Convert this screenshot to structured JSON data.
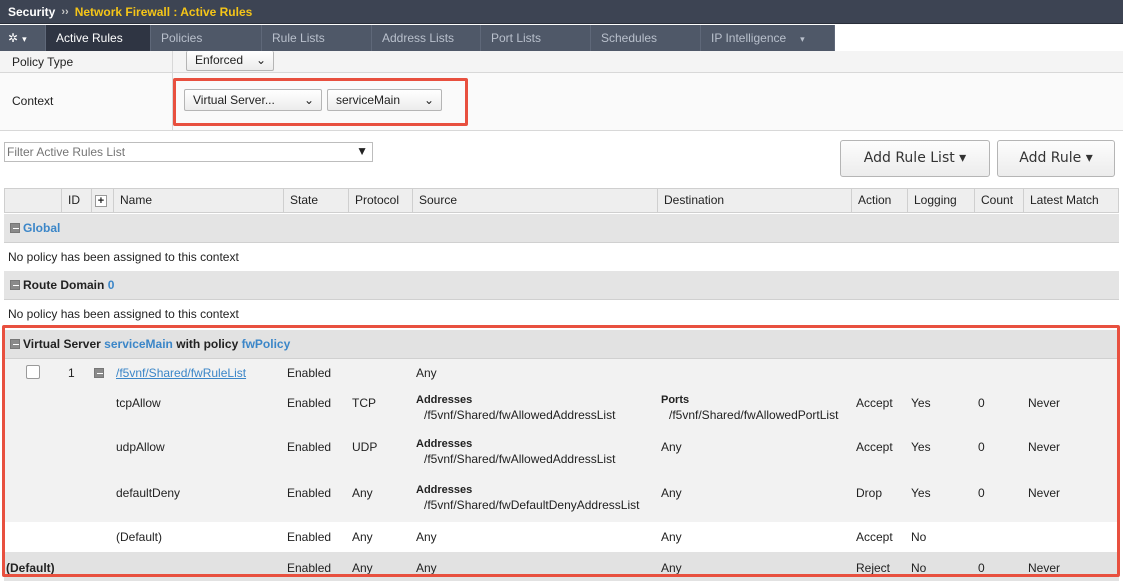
{
  "breadcrumb": {
    "root": "Security",
    "separator": "››",
    "page": "Network Firewall : Active Rules"
  },
  "tabs": [
    {
      "label": "Active Rules"
    },
    {
      "label": "Policies"
    },
    {
      "label": "Rule Lists"
    },
    {
      "label": "Address Lists"
    },
    {
      "label": "Port Lists"
    },
    {
      "label": "Schedules"
    },
    {
      "label": "IP Intelligence"
    }
  ],
  "context_form": {
    "policy_type_label": "Policy Type",
    "policy_type_value": "Enforced",
    "context_label": "Context",
    "context_type_value": "Virtual Server...",
    "context_object_value": "serviceMain"
  },
  "filter": {
    "placeholder": "Filter Active Rules List"
  },
  "buttons": {
    "add_rule_list": "Add Rule List ▾",
    "add_rule": "Add Rule ▾"
  },
  "columns": [
    "ID",
    "Name",
    "State",
    "Protocol",
    "Source",
    "Destination",
    "Action",
    "Logging",
    "Count",
    "Latest Match"
  ],
  "groups": {
    "global": {
      "label": "Global",
      "message": "No policy has been assigned to this context"
    },
    "route_domain": {
      "prefix": "Route Domain",
      "id": "0",
      "message": "No policy has been assigned to this context"
    },
    "virtual_server": {
      "prefix": "Virtual Server",
      "name": "serviceMain",
      "middle": "with policy",
      "policy": "fwPolicy"
    }
  },
  "rule_list_row": {
    "id": "1",
    "name": "/f5vnf/Shared/fwRuleList",
    "state": "Enabled",
    "source": "Any"
  },
  "rules": [
    {
      "name": "tcpAllow",
      "state": "Enabled",
      "protocol": "TCP",
      "source_label": "Addresses",
      "source_value": "/f5vnf/Shared/fwAllowedAddressList",
      "dest_label": "Ports",
      "dest_value": "/f5vnf/Shared/fwAllowedPortList",
      "action": "Accept",
      "logging": "Yes",
      "count": "0",
      "latest_match": "Never"
    },
    {
      "name": "udpAllow",
      "state": "Enabled",
      "protocol": "UDP",
      "source_label": "Addresses",
      "source_value": "/f5vnf/Shared/fwAllowedAddressList",
      "dest_label": "",
      "dest_value": "Any",
      "action": "Accept",
      "logging": "Yes",
      "count": "0",
      "latest_match": "Never"
    },
    {
      "name": "defaultDeny",
      "state": "Enabled",
      "protocol": "Any",
      "source_label": "Addresses",
      "source_value": "/f5vnf/Shared/fwDefaultDenyAddressList",
      "dest_label": "",
      "dest_value": "Any",
      "action": "Drop",
      "logging": "Yes",
      "count": "0",
      "latest_match": "Never"
    }
  ],
  "default_row": {
    "name": "(Default)",
    "state": "Enabled",
    "protocol": "Any",
    "source": "Any",
    "destination": "Any",
    "action": "Accept",
    "logging": "No"
  },
  "global_default_row": {
    "name": "(Default)",
    "state": "Enabled",
    "protocol": "Any",
    "source": "Any",
    "destination": "Any",
    "action": "Reject",
    "logging": "No",
    "count": "0",
    "latest_match": "Never"
  },
  "colors": {
    "accent_link": "#3b86c8",
    "breadcrumb_highlight": "#f5c518",
    "highlight_box": "#e8503f",
    "titlebar": "#3d4453"
  }
}
